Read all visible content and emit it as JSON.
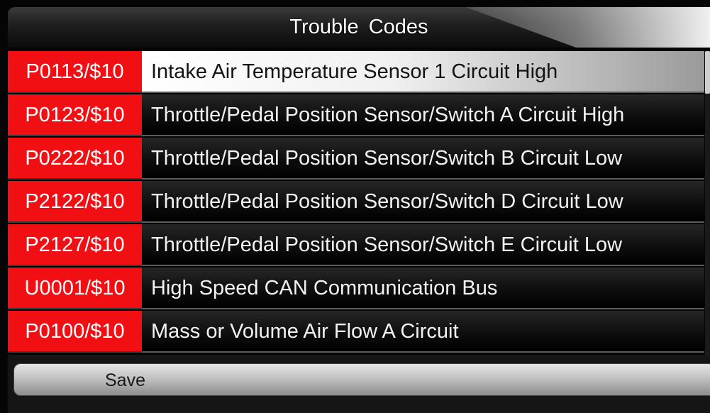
{
  "header": {
    "title": "Trouble  Codes"
  },
  "codes": [
    {
      "code": "P0113/$10",
      "description": "Intake Air Temperature Sensor 1 Circuit High",
      "selected": true
    },
    {
      "code": "P0123/$10",
      "description": "Throttle/Pedal Position Sensor/Switch A Circuit High",
      "selected": false
    },
    {
      "code": "P0222/$10",
      "description": "Throttle/Pedal Position Sensor/Switch B Circuit Low",
      "selected": false
    },
    {
      "code": "P2122/$10",
      "description": "Throttle/Pedal Position Sensor/Switch D Circuit Low",
      "selected": false
    },
    {
      "code": "P2127/$10",
      "description": "Throttle/Pedal Position Sensor/Switch E Circuit Low",
      "selected": false
    },
    {
      "code": "U0001/$10",
      "description": "High Speed CAN Communication Bus",
      "selected": false
    },
    {
      "code": "P0100/$10",
      "description": "Mass or Volume Air Flow A Circuit",
      "selected": false
    }
  ],
  "scroll": {
    "visible_fraction": 0.14
  },
  "footer": {
    "save_label": "Save"
  },
  "colors": {
    "code_background": "#f20f14",
    "row_background": "#0c0c0c",
    "selected_row": "#f0f0f0"
  }
}
